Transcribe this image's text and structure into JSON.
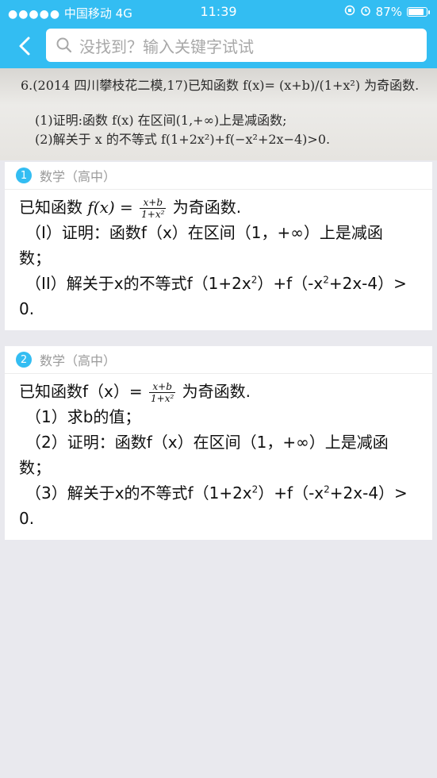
{
  "status_bar": {
    "signal_dots": "●●●●●",
    "carrier": "中国移动",
    "network": "4G",
    "time": "11:39",
    "battery": "87%",
    "battery_level": 0.87
  },
  "search": {
    "placeholder": "没找到？输入关键字试试"
  },
  "photo": {
    "line1": "6.(2014 四川攀枝花二模,17)已知函数 f(x)= (x+b)/(1+x²) 为奇函数.",
    "line2": "(1)证明:函数 f(x) 在区间(1,+∞)上是减函数;",
    "line3": "(2)解关于 x 的不等式 f(1+2x²)+f(−x²+2x−4)>0."
  },
  "results": [
    {
      "index": "1",
      "subject": "数学（高中）",
      "lines": {
        "intro_pre": "已知函数",
        "func": "f(x) =",
        "num": "x+b",
        "den": "1+x²",
        "intro_post": "为奇函数.",
        "p1": "（I）证明：函数f（x）在区间（1，+∞）上是减函",
        "p1b": "数；",
        "p2a": "（II）解关于x的不等式f（1+2x",
        "p2b": "）+f（-x",
        "p2c": "+2x-4）>",
        "sup": "2",
        "end": "0."
      }
    },
    {
      "index": "2",
      "subject": "数学（高中）",
      "lines": {
        "intro_pre": "已知函数f（x）=",
        "num": "x+b",
        "den": "1+x²",
        "intro_post": "为奇函数.",
        "p1": "（1）求b的值；",
        "p2": "（2）证明：函数f（x）在区间（1，+∞）上是减函",
        "p2b": "数；",
        "p3a": "（3）解关于x的不等式f（1+2x",
        "p3b": "）+f（-x",
        "p3c": "+2x-4）>",
        "sup": "2",
        "end": "0."
      }
    }
  ]
}
